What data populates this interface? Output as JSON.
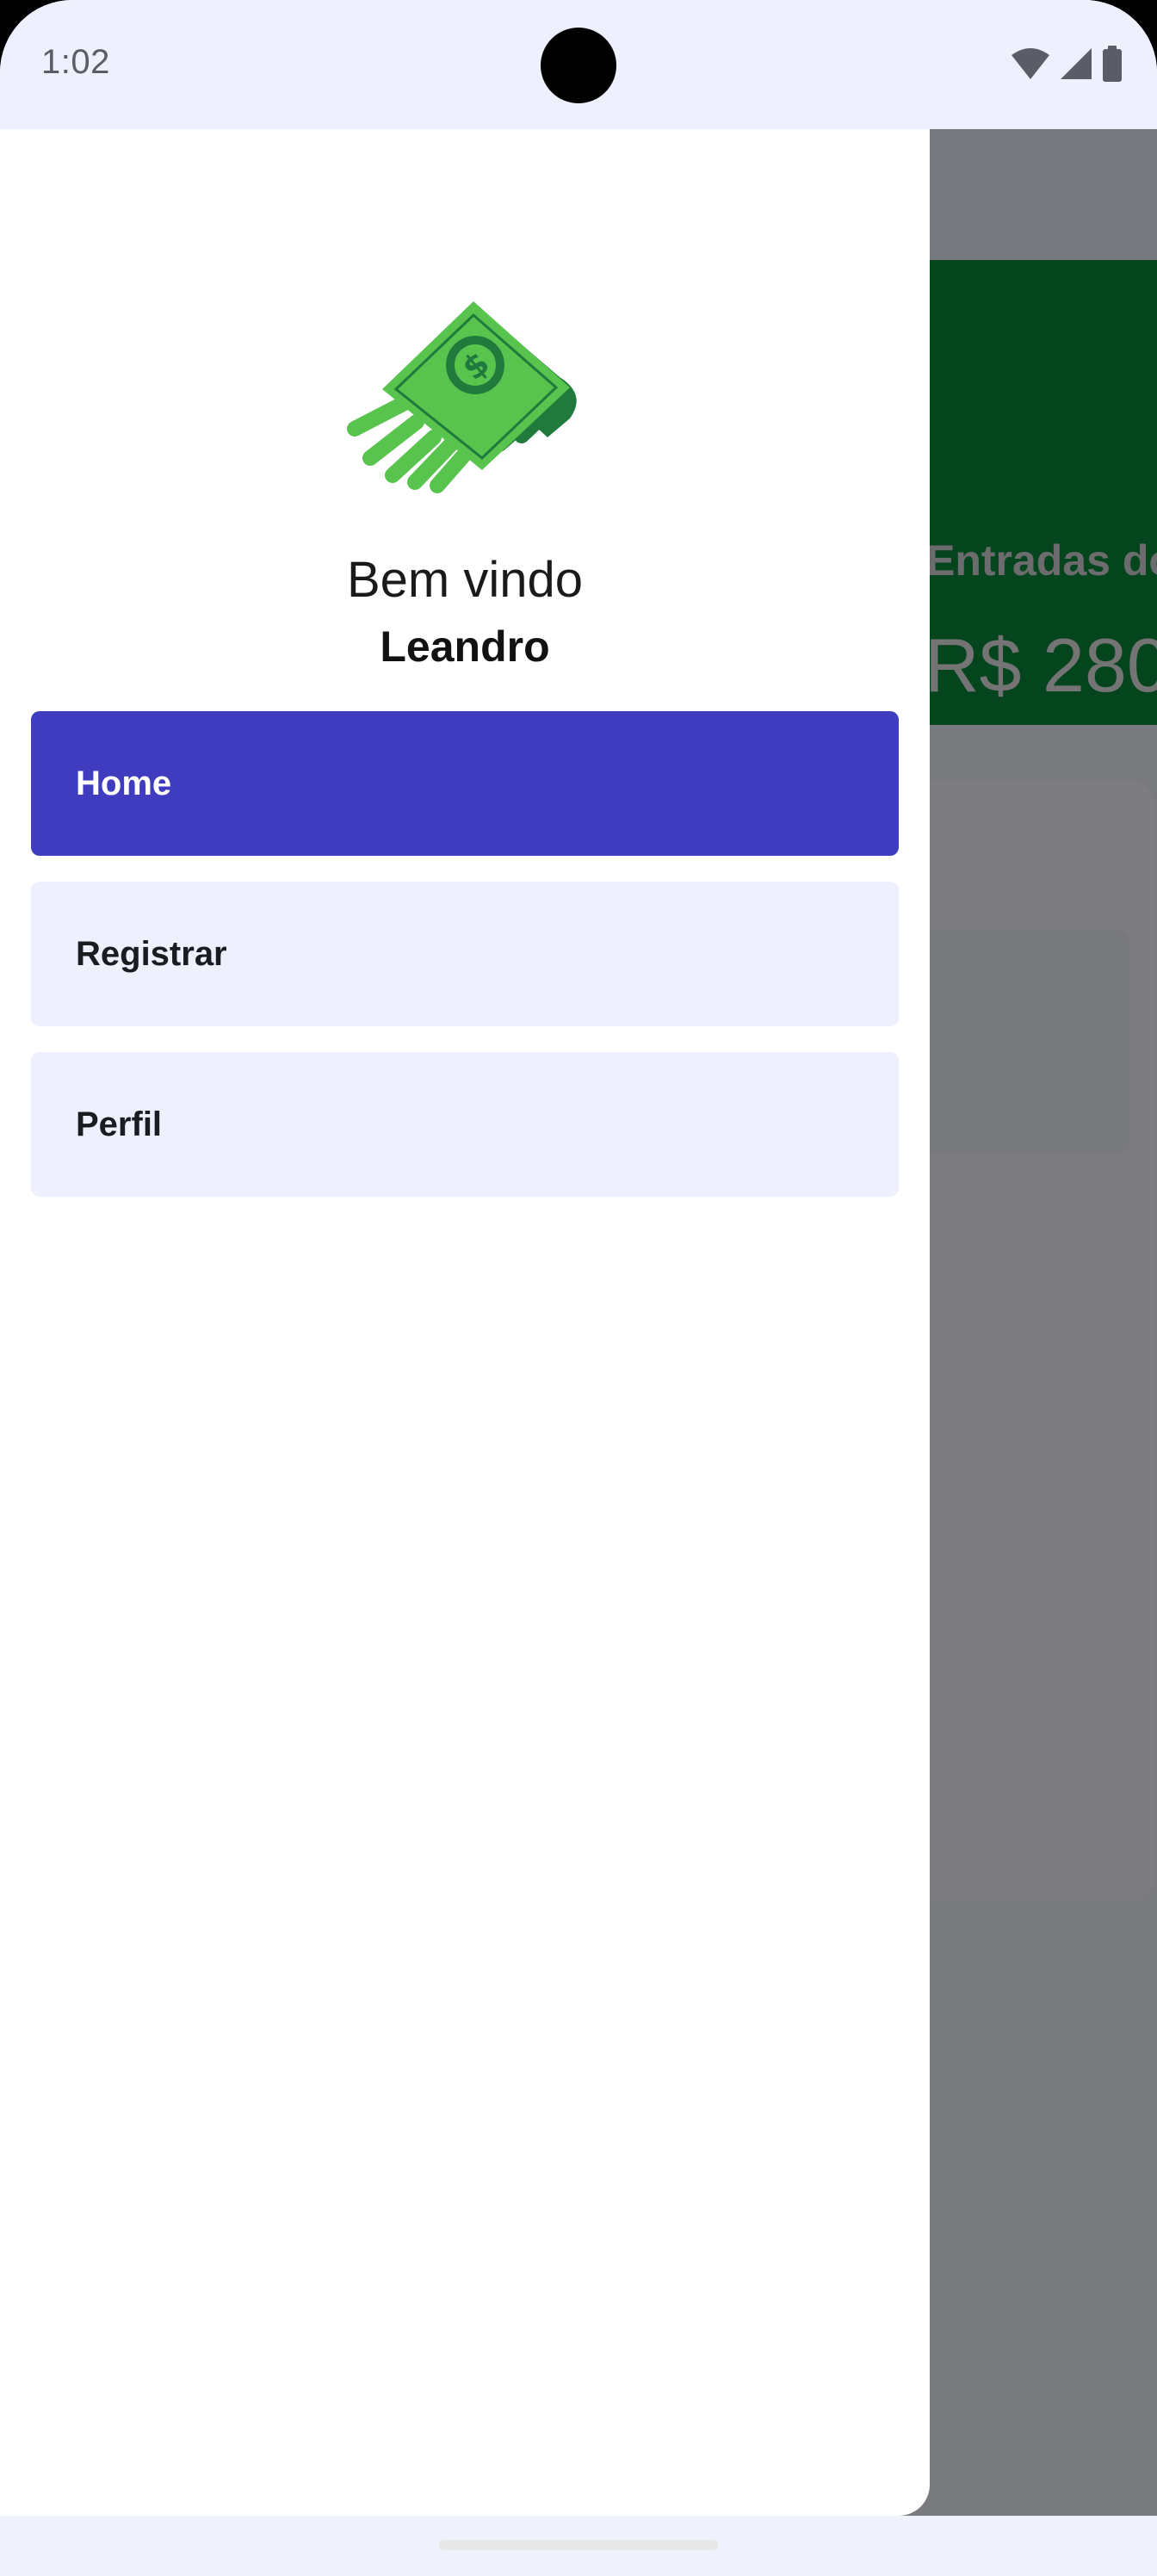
{
  "status_bar": {
    "time": "1:02",
    "icons": [
      "wifi-icon",
      "cell-signal-icon",
      "battery-icon"
    ]
  },
  "background_app": {
    "summary_label": "Entradas do",
    "summary_value": "R$ 280"
  },
  "drawer": {
    "logo_icon": "money-bill-icon",
    "welcome": "Bem vindo",
    "username": "Leandro",
    "items": [
      {
        "label": "Home",
        "active": true
      },
      {
        "label": "Registrar",
        "active": false
      },
      {
        "label": "Perfil",
        "active": false
      }
    ]
  },
  "colors": {
    "accent": "#3f3cc0",
    "item_bg": "#eef1fd",
    "income_green": "#0a8a3a"
  }
}
